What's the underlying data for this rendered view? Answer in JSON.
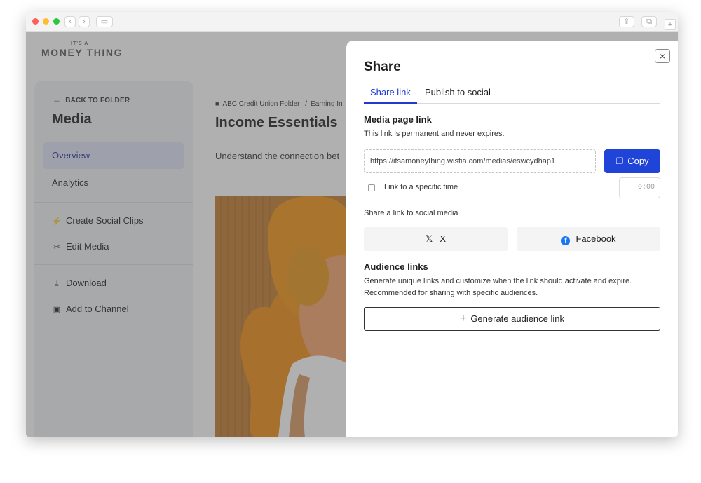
{
  "browser": {
    "back_glyph": "‹",
    "forward_glyph": "›",
    "sidebar_toggle_glyph": "▭",
    "share_glyph": "⇪",
    "tabs_glyph": "⧉",
    "new_tab_glyph": "+"
  },
  "header": {
    "logo_small": "IT'S A",
    "logo_big": "MONEY THING"
  },
  "sidebar": {
    "back_label": "BACK TO FOLDER",
    "title": "Media",
    "items": [
      {
        "label": "Overview",
        "icon": "none",
        "active": true
      },
      {
        "label": "Analytics",
        "icon": "none",
        "active": false
      },
      {
        "label": "Create Social Clips",
        "icon": "lightning-icon",
        "active": false
      },
      {
        "label": "Edit Media",
        "icon": "scissors-icon",
        "active": false
      },
      {
        "label": "Download",
        "icon": "download-icon",
        "active": false
      },
      {
        "label": "Add to Channel",
        "icon": "channel-icon",
        "active": false
      }
    ]
  },
  "main": {
    "breadcrumb_folder": "ABC Credit Union Folder",
    "breadcrumb_sep": "/",
    "breadcrumb_current": "Earning In",
    "title": "Income Essentials",
    "description": "Understand the connection bet"
  },
  "modal": {
    "title": "Share",
    "close_glyph": "×",
    "tabs": [
      {
        "label": "Share link",
        "active": true
      },
      {
        "label": "Publish to social",
        "active": false
      }
    ],
    "media_link": {
      "title": "Media page link",
      "subtitle": "This link is permanent and never expires.",
      "url": "https://itsamoneything.wistia.com/medias/eswcydhap1",
      "copy_label": "Copy"
    },
    "specific_time": {
      "label": "Link to a specific time",
      "checked": false,
      "time_value": "0:00"
    },
    "social": {
      "title": "Share a link to social media",
      "x_label": "X",
      "x_glyph": "𝕏",
      "facebook_label": "Facebook",
      "facebook_glyph": "f"
    },
    "audience": {
      "title": "Audience links",
      "desc_line1": "Generate unique links and customize when the link should activate and expire.",
      "desc_line2": "Recommended for sharing with specific audiences.",
      "button_label": "Generate audience link",
      "button_glyph": "+"
    }
  },
  "colors": {
    "accent": "#2044d8",
    "overlay": "#505050",
    "thumbnail": "#c77e2c"
  }
}
